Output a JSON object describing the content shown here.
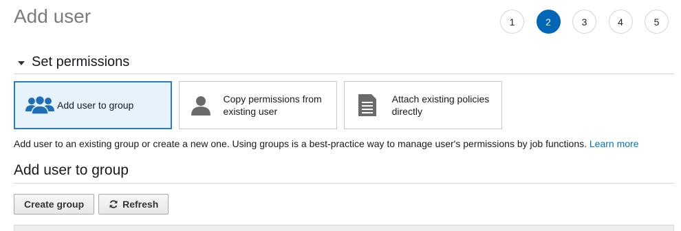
{
  "page": {
    "title": "Add user"
  },
  "steps": {
    "items": [
      "1",
      "2",
      "3",
      "4",
      "5"
    ],
    "active": "2"
  },
  "permissions": {
    "header": "Set permissions",
    "options": [
      {
        "label": "Add user to group",
        "icon": "users-group-icon",
        "selected": true
      },
      {
        "label": "Copy permissions from existing user",
        "icon": "user-icon",
        "selected": false
      },
      {
        "label": "Attach existing policies directly",
        "icon": "document-icon",
        "selected": false
      }
    ],
    "help_text": "Add user to an existing group or create a new one. Using groups is a best-practice way to manage user's permissions by job functions.",
    "learn_more": "Learn more"
  },
  "group_section": {
    "title": "Add user to group",
    "create_button": "Create group",
    "refresh_button": "Refresh"
  },
  "colors": {
    "accent": "#0066b6",
    "selected_bg": "#e7f3fc",
    "selected_border": "#2b7bc0",
    "link": "#0073bb"
  }
}
